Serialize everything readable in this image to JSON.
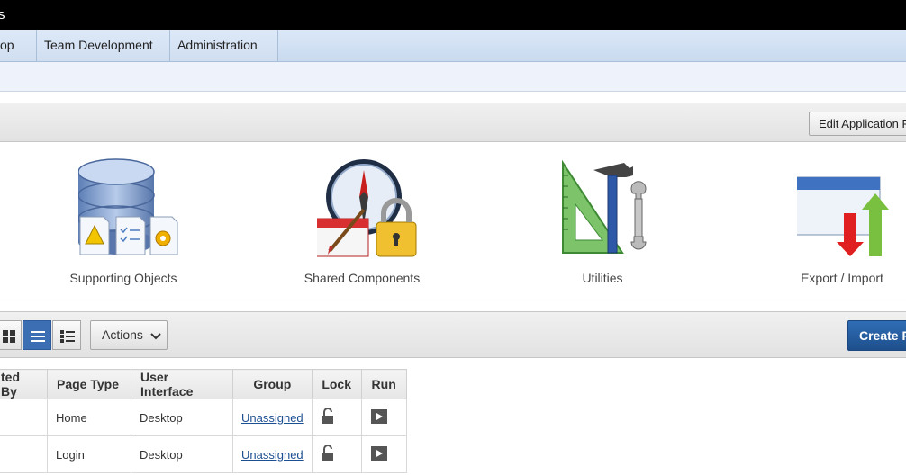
{
  "window": {
    "title_fragment": "s"
  },
  "nav": {
    "tabs": [
      {
        "label": "op"
      },
      {
        "label": "Team Development"
      },
      {
        "label": "Administration"
      }
    ]
  },
  "region": {
    "edit_button_label": "Edit Application P",
    "tiles": [
      {
        "label": "Supporting Objects",
        "icon": "database-icon"
      },
      {
        "label": "Shared Components",
        "icon": "compass-icon"
      },
      {
        "label": "Utilities",
        "icon": "tools-icon"
      },
      {
        "label": "Export / Import",
        "icon": "export-import-icon"
      }
    ]
  },
  "toolbar": {
    "actions_label": "Actions",
    "create_label": "Create P",
    "view_modes": [
      "grid-view-icon",
      "list-view-icon",
      "detail-view-icon"
    ],
    "active_view": "list-view-icon",
    "accent": "#3c6eb4"
  },
  "table": {
    "headers": [
      "ted By",
      "Page Type",
      "User Interface",
      "Group",
      "Lock",
      "Run"
    ],
    "rows": [
      {
        "updated_by": "",
        "page_type": "Home",
        "ui": "Desktop",
        "group": "Unassigned",
        "lock": "unlock-icon",
        "run": "run-icon"
      },
      {
        "updated_by": "",
        "page_type": "Login",
        "ui": "Desktop",
        "group": "Unassigned",
        "lock": "unlock-icon",
        "run": "run-icon"
      }
    ]
  }
}
